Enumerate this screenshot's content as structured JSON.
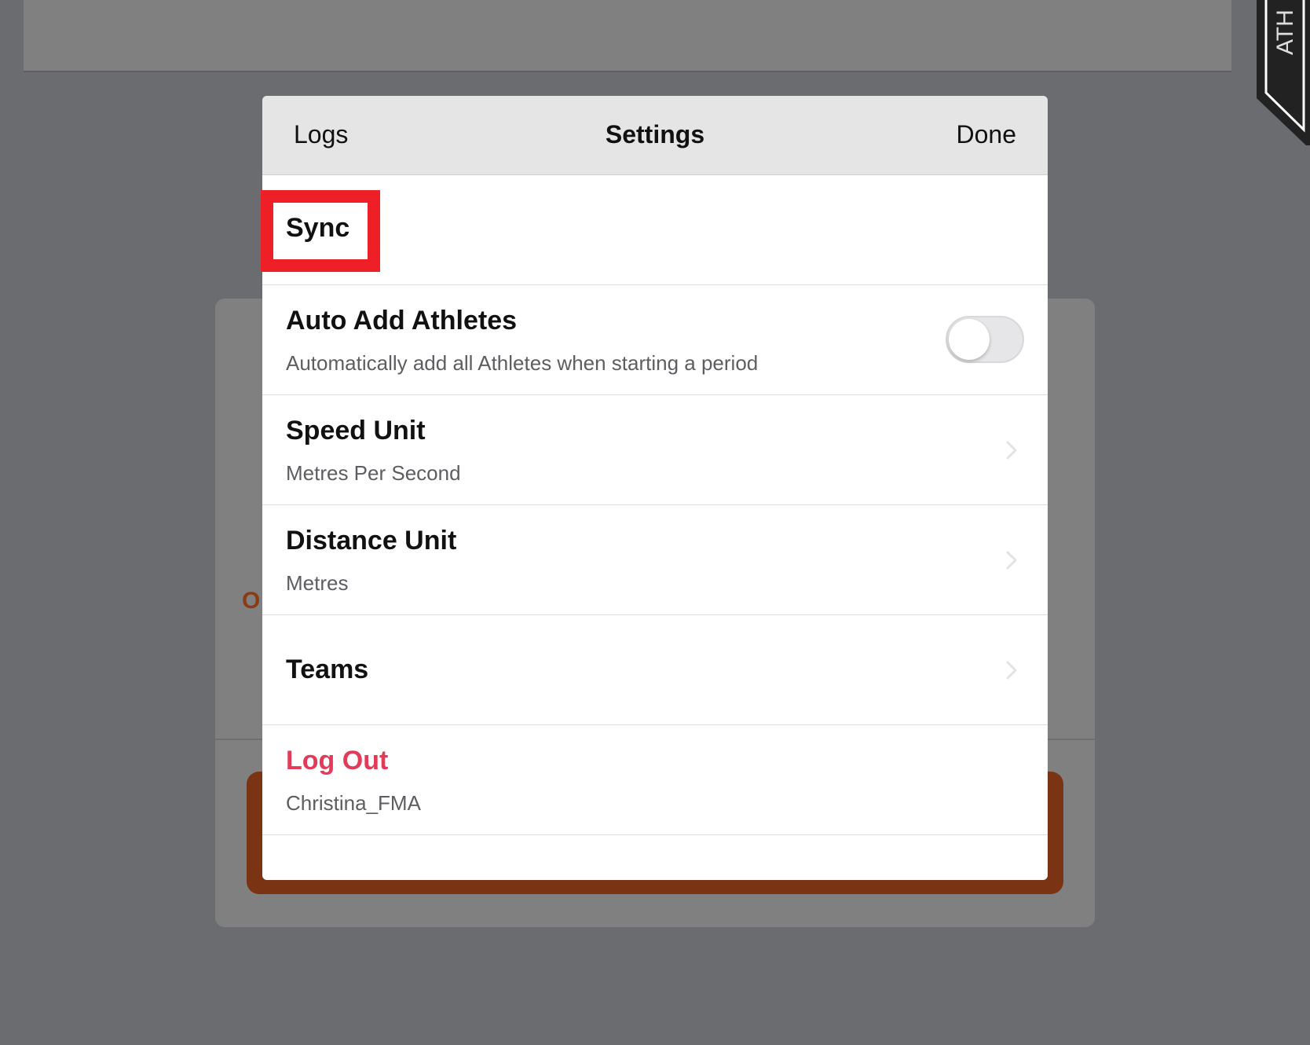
{
  "background": {
    "banner_text": "ATH",
    "card_letter": "O"
  },
  "header": {
    "left_button": "Logs",
    "title": "Settings",
    "right_button": "Done"
  },
  "settings": {
    "sync": {
      "title": "Sync"
    },
    "auto_add": {
      "title": "Auto Add Athletes",
      "subtitle": "Automatically add all Athletes when starting a period",
      "toggle_on": false
    },
    "speed_unit": {
      "title": "Speed Unit",
      "value": "Metres Per Second"
    },
    "distance_unit": {
      "title": "Distance Unit",
      "value": "Metres"
    },
    "teams": {
      "title": "Teams"
    },
    "log_out": {
      "title": "Log Out",
      "username": "Christina_FMA"
    }
  },
  "colors": {
    "highlight": "#ee1f27",
    "logout": "#e33a5a",
    "accent_orange": "#7a3413"
  }
}
